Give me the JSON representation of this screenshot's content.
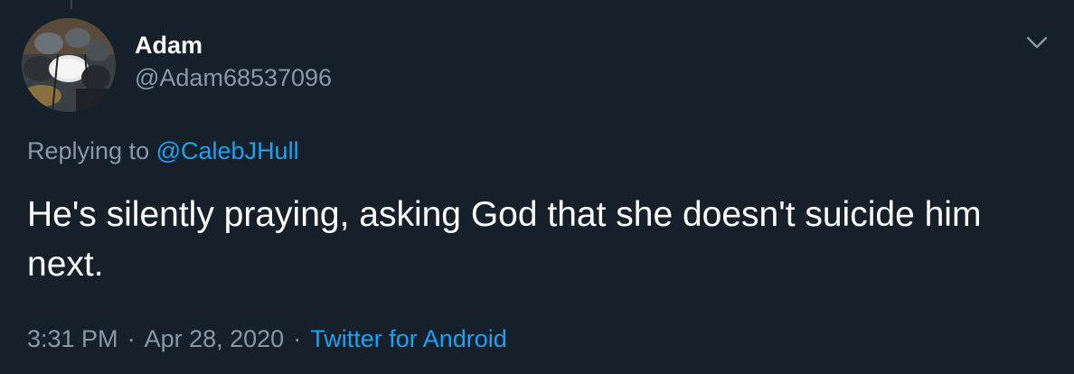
{
  "user": {
    "display_name": "Adam",
    "handle": "@Adam68537096"
  },
  "reply": {
    "prefix": "Replying to",
    "mention": "@CalebJHull"
  },
  "tweet": {
    "text": "He's silently praying, asking God that she doesn't suicide him next."
  },
  "meta": {
    "time": "3:31 PM",
    "separator": "·",
    "date": "Apr 28, 2020",
    "source": "Twitter for Android"
  },
  "icons": {
    "caret": "chevron-down-icon",
    "avatar": "drum-kit-photo"
  },
  "colors": {
    "background": "#15202b",
    "primary_text": "#ffffff",
    "secondary_text": "#8899a6",
    "accent": "#1da1f2"
  }
}
